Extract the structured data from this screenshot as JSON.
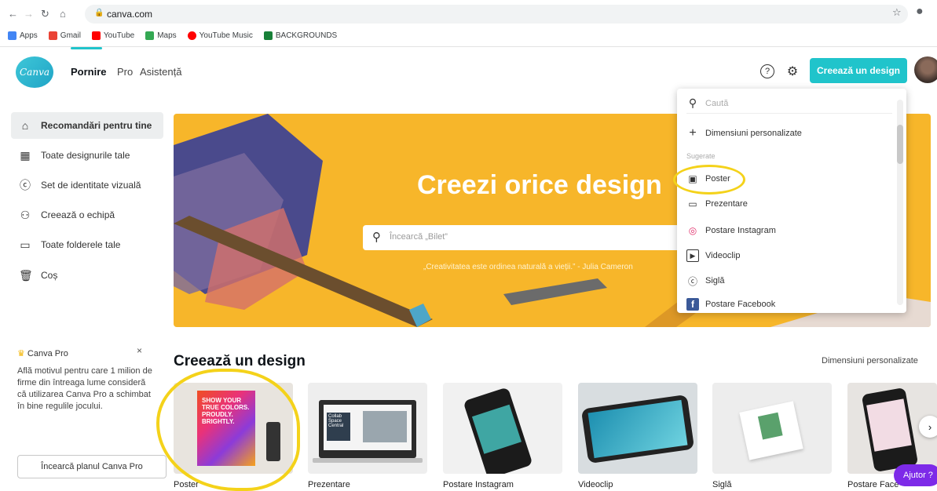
{
  "browser": {
    "url": "canva.com",
    "bookmarks": [
      {
        "label": "Apps",
        "color": "#4285f4"
      },
      {
        "label": "Gmail",
        "color": "#ea4335"
      },
      {
        "label": "YouTube",
        "color": "#ff0000"
      },
      {
        "label": "Maps",
        "color": "#34a853"
      },
      {
        "label": "YouTube Music",
        "color": "#ff0000"
      },
      {
        "label": "BACKGROUNDS",
        "color": "#188038"
      }
    ]
  },
  "header": {
    "logo_text": "Canva",
    "nav": [
      "Pornire",
      "Pro",
      "Asistență"
    ],
    "help_icon": "?",
    "settings_icon": "⚙",
    "create_button": "Creează un design"
  },
  "sidebar": {
    "items": [
      {
        "label": "Recomandări pentru tine",
        "icon": "⌂"
      },
      {
        "label": "Toate designurile tale",
        "icon": "▦"
      },
      {
        "label": "Set de identitate vizuală",
        "icon": "ⓒ"
      },
      {
        "label": "Creează o echipă",
        "icon": "⚇"
      },
      {
        "label": "Toate folderele tale",
        "icon": "▭"
      },
      {
        "label": "Coș",
        "icon": "🗑"
      }
    ],
    "pro_card": {
      "title": "Canva Pro",
      "close": "×",
      "text": "Află motivul pentru care 1 milion de firme din întreaga lume consideră că utilizarea Canva Pro a schimbat în bine regulile jocului.",
      "button": "Încearcă planul Canva Pro"
    }
  },
  "banner": {
    "title": "Creezi orice design",
    "search_placeholder": "Încearcă „Bilet”",
    "quote": "„Creativitatea este ordinea naturală a vieții.” - Julia Cameron"
  },
  "dropdown": {
    "search_placeholder": "Caută",
    "custom": "Dimensiuni personalizate",
    "section": "Sugerate",
    "items": [
      {
        "label": "Poster",
        "icon": "▣"
      },
      {
        "label": "Prezentare",
        "icon": "▭"
      },
      {
        "label": "Postare Instagram",
        "icon": "◎"
      },
      {
        "label": "Videoclip",
        "icon": "▶"
      },
      {
        "label": "Siglă",
        "icon": "ⓒ"
      },
      {
        "label": "Postare Facebook",
        "icon": "f"
      }
    ]
  },
  "designs": {
    "title": "Creează un design",
    "custom_link": "Dimensiuni personalizate",
    "poster_text": "SHOW YOUR TRUE COLORS. PROUDLY. BRIGHTLY.",
    "presentation_text": "Collab Space Central",
    "cards": [
      "Poster",
      "Prezentare",
      "Postare Instagram",
      "Videoclip",
      "Siglă",
      "Postare Face"
    ],
    "next": "›",
    "help": "Ajutor ?"
  },
  "colors": {
    "accent": "#20c4cb",
    "banner": "#f7b62a",
    "highlight": "#f4d21a",
    "help": "#7d2ae8"
  }
}
